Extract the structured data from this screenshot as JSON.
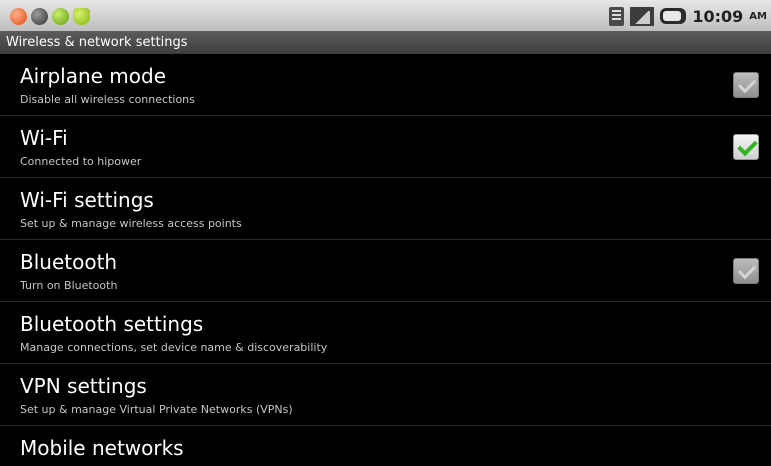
{
  "status_bar": {
    "notification_icons": [
      "warning-icon",
      "record-icon",
      "sync-icon",
      "android-icon"
    ],
    "right_icons": [
      "sd-card-icon",
      "signal-icon",
      "battery-icon"
    ],
    "time": "10:09",
    "ampm": "AM"
  },
  "header": {
    "title": "Wireless & network settings"
  },
  "settings": [
    {
      "title": "Airplane mode",
      "summary": "Disable all wireless connections",
      "checkbox": "unchecked"
    },
    {
      "title": "Wi-Fi",
      "summary": "Connected to hipower",
      "checkbox": "checked"
    },
    {
      "title": "Wi-Fi settings",
      "summary": "Set up & manage wireless access points"
    },
    {
      "title": "Bluetooth",
      "summary": "Turn on Bluetooth",
      "checkbox": "unchecked"
    },
    {
      "title": "Bluetooth settings",
      "summary": "Manage connections, set device name & discoverability"
    },
    {
      "title": "VPN settings",
      "summary": "Set up & manage Virtual Private Networks (VPNs)"
    },
    {
      "title": "Mobile networks"
    }
  ],
  "colors": {
    "background": "#000000",
    "check_accent": "#31b324",
    "title_bar": "#4a4a4a",
    "status_bar": "#d0d0d0"
  }
}
